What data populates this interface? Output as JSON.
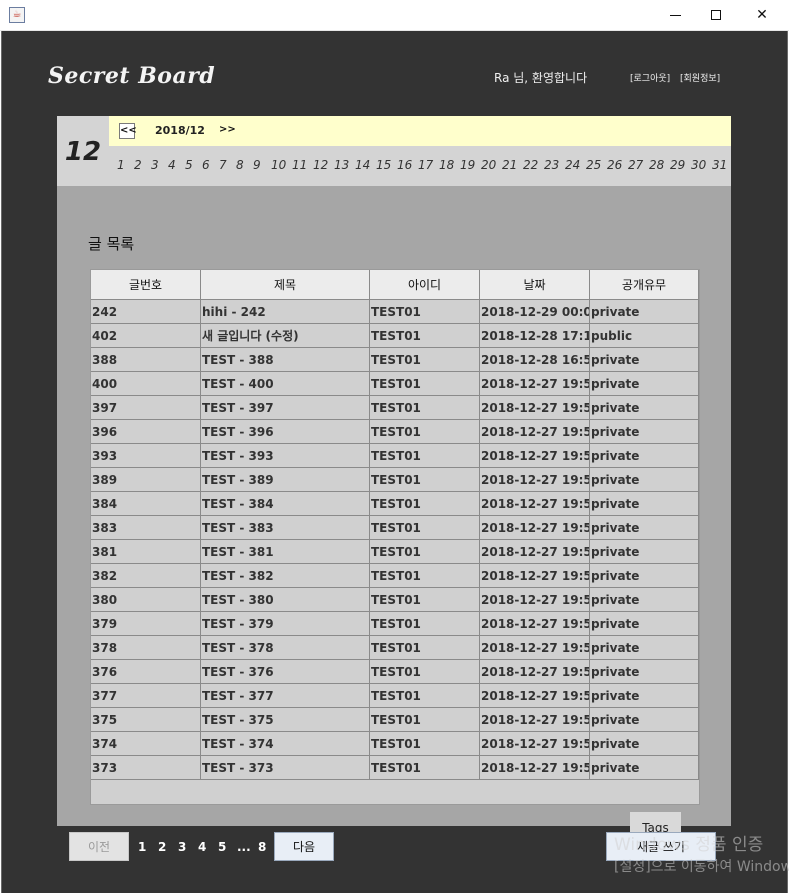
{
  "window": {
    "controls": {
      "minimize": "",
      "maximize": "",
      "close": "✕"
    }
  },
  "header": {
    "logo": "Secret Board",
    "welcome": "Ra 님, 환영합니다",
    "logout": "[로그아웃]",
    "member_info": "[회원정보]"
  },
  "calendar": {
    "month": "12",
    "prev": "<<",
    "title": "2018/12",
    "next": ">>",
    "days": [
      "1",
      "2",
      "3",
      "4",
      "5",
      "6",
      "7",
      "8",
      "9",
      "10",
      "11",
      "12",
      "13",
      "14",
      "15",
      "16",
      "17",
      "18",
      "19",
      "20",
      "21",
      "22",
      "23",
      "24",
      "25",
      "26",
      "27",
      "28",
      "29",
      "30",
      "31"
    ]
  },
  "list": {
    "title": "글 목록",
    "columns": [
      "글번호",
      "제목",
      "아이디",
      "날짜",
      "공개유무"
    ],
    "rows": [
      [
        "242",
        "hihi - 242",
        "TEST01",
        "2018-12-29 00:0...",
        "private"
      ],
      [
        "402",
        "새 글입니다 (수정)",
        "TEST01",
        "2018-12-28 17:1...",
        "public"
      ],
      [
        "388",
        "TEST - 388",
        "TEST01",
        "2018-12-28 16:5...",
        "private"
      ],
      [
        "400",
        "TEST - 400",
        "TEST01",
        "2018-12-27 19:5...",
        "private"
      ],
      [
        "397",
        "TEST - 397",
        "TEST01",
        "2018-12-27 19:5...",
        "private"
      ],
      [
        "396",
        "TEST - 396",
        "TEST01",
        "2018-12-27 19:5...",
        "private"
      ],
      [
        "393",
        "TEST - 393",
        "TEST01",
        "2018-12-27 19:5...",
        "private"
      ],
      [
        "389",
        "TEST - 389",
        "TEST01",
        "2018-12-27 19:5...",
        "private"
      ],
      [
        "384",
        "TEST - 384",
        "TEST01",
        "2018-12-27 19:5...",
        "private"
      ],
      [
        "383",
        "TEST - 383",
        "TEST01",
        "2018-12-27 19:5...",
        "private"
      ],
      [
        "381",
        "TEST - 381",
        "TEST01",
        "2018-12-27 19:5...",
        "private"
      ],
      [
        "382",
        "TEST - 382",
        "TEST01",
        "2018-12-27 19:5...",
        "private"
      ],
      [
        "380",
        "TEST - 380",
        "TEST01",
        "2018-12-27 19:5...",
        "private"
      ],
      [
        "379",
        "TEST - 379",
        "TEST01",
        "2018-12-27 19:5...",
        "private"
      ],
      [
        "378",
        "TEST - 378",
        "TEST01",
        "2018-12-27 19:5...",
        "private"
      ],
      [
        "376",
        "TEST - 376",
        "TEST01",
        "2018-12-27 19:5...",
        "private"
      ],
      [
        "377",
        "TEST - 377",
        "TEST01",
        "2018-12-27 19:5...",
        "private"
      ],
      [
        "375",
        "TEST - 375",
        "TEST01",
        "2018-12-27 19:5...",
        "private"
      ],
      [
        "374",
        "TEST - 374",
        "TEST01",
        "2018-12-27 19:5...",
        "private"
      ],
      [
        "373",
        "TEST - 373",
        "TEST01",
        "2018-12-27 19:5...",
        "private"
      ]
    ],
    "tags_label": "Tags"
  },
  "pagination": {
    "prev_label": "이전",
    "pages": [
      "1",
      "2",
      "3",
      "4",
      "5",
      "...",
      "8"
    ],
    "next_label": "다음",
    "write_label": "새글 쓰기"
  },
  "watermark": {
    "line1": "Windows 정품 인증",
    "line2": "[설정]으로 이동하여 Windows"
  }
}
